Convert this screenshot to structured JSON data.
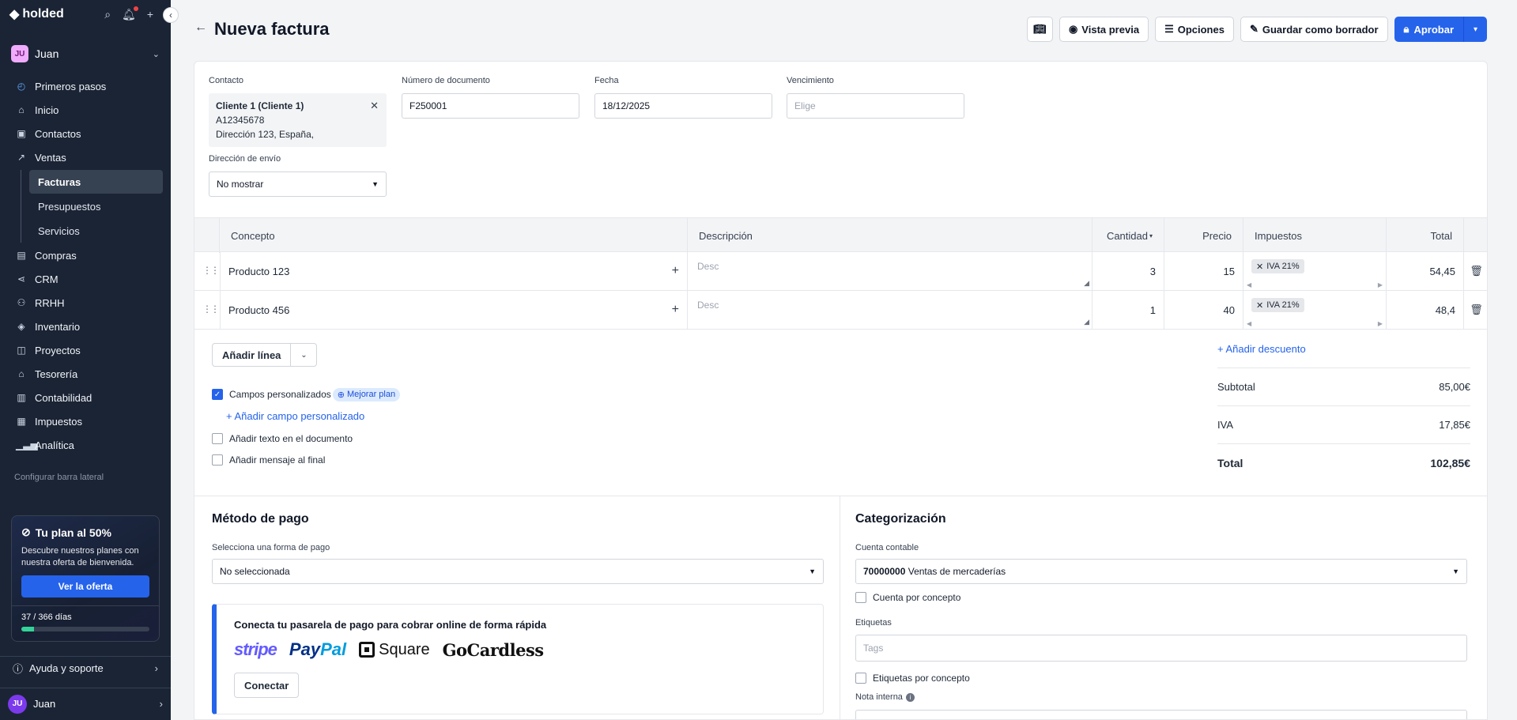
{
  "sidebar": {
    "logo": "holded",
    "user": {
      "initials": "JU",
      "name": "Juan"
    },
    "nav": [
      {
        "label": "Primeros pasos",
        "icon": "progress-icon"
      },
      {
        "label": "Inicio",
        "icon": "home-icon"
      },
      {
        "label": "Contactos",
        "icon": "contacts-icon"
      },
      {
        "label": "Ventas",
        "icon": "chart-line-icon"
      }
    ],
    "ventas_sub": [
      "Facturas",
      "Presupuestos",
      "Servicios"
    ],
    "nav2": [
      {
        "label": "Compras",
        "icon": "receipt-icon"
      },
      {
        "label": "CRM",
        "icon": "share-icon"
      },
      {
        "label": "RRHH",
        "icon": "people-icon"
      },
      {
        "label": "Inventario",
        "icon": "layers-icon"
      },
      {
        "label": "Proyectos",
        "icon": "projects-icon"
      },
      {
        "label": "Tesorería",
        "icon": "bank-icon"
      },
      {
        "label": "Contabilidad",
        "icon": "books-icon"
      },
      {
        "label": "Impuestos",
        "icon": "tax-icon"
      },
      {
        "label": "Analítica",
        "icon": "bar-chart-icon"
      }
    ],
    "config_label": "Configurar barra lateral",
    "promo": {
      "title": "Tu plan al 50%",
      "desc": "Descubre nuestros planes con nuestra oferta de bienvenida.",
      "button": "Ver la oferta",
      "days": "37 / 366 días",
      "progress_fraction": 0.1
    },
    "help": "Ayuda y soporte",
    "bottom_user": {
      "initials": "JU",
      "name": "Juan"
    }
  },
  "header": {
    "title": "Nueva factura",
    "preview": "Vista previa",
    "options": "Opciones",
    "draft": "Guardar como borrador",
    "approve": "Aprobar"
  },
  "form": {
    "contact_label": "Contacto",
    "contact_name": "Cliente 1 (Cliente 1)",
    "contact_id": "A12345678",
    "contact_address": "Dirección 123, España,",
    "doc_label": "Número de documento",
    "doc_value": "F250001",
    "date_label": "Fecha",
    "date_value": "18/12/2025",
    "due_label": "Vencimiento",
    "due_placeholder": "Elige",
    "ship_label": "Dirección de envío",
    "ship_value": "No mostrar"
  },
  "table": {
    "headers": {
      "concept": "Concepto",
      "desc": "Descripción",
      "qty": "Cantidad",
      "price": "Precio",
      "taxes": "Impuestos",
      "total": "Total"
    },
    "desc_placeholder": "Desc",
    "rows": [
      {
        "concept": "Producto 123",
        "qty": "3",
        "price": "15",
        "tax": "IVA 21%",
        "total": "54,45"
      },
      {
        "concept": "Producto 456",
        "qty": "1",
        "price": "40",
        "tax": "IVA 21%",
        "total": "48,4"
      }
    ]
  },
  "extras": {
    "add_line": "Añadir línea",
    "custom_fields": "Campos personalizados",
    "upgrade": "Mejorar plan",
    "add_custom": "Añadir campo personalizado",
    "add_text": "Añadir texto en el documento",
    "add_message": "Añadir mensaje al final"
  },
  "totals": {
    "add_discount": "+ Añadir descuento",
    "subtotal_label": "Subtotal",
    "subtotal": "85,00€",
    "iva_label": "IVA",
    "iva": "17,85€",
    "total_label": "Total",
    "total": "102,85€"
  },
  "payment": {
    "title": "Método de pago",
    "select_label": "Selecciona una forma de pago",
    "select_value": "No seleccionada",
    "gateway_title": "Conecta tu pasarela de pago para cobrar online de forma rápida",
    "logos": {
      "stripe": "stripe",
      "paypal_a": "Pay",
      "paypal_b": "Pal",
      "square": "Square",
      "gocardless": "GoCardless"
    },
    "connect": "Conectar"
  },
  "categorization": {
    "title": "Categorización",
    "account_label": "Cuenta contable",
    "account_code": "70000000",
    "account_name": "Ventas de mercaderías",
    "per_concept": "Cuenta por concepto",
    "tags_label": "Etiquetas",
    "tags_placeholder": "Tags",
    "tags_per_concept": "Etiquetas por concepto",
    "note_label": "Nota interna"
  }
}
